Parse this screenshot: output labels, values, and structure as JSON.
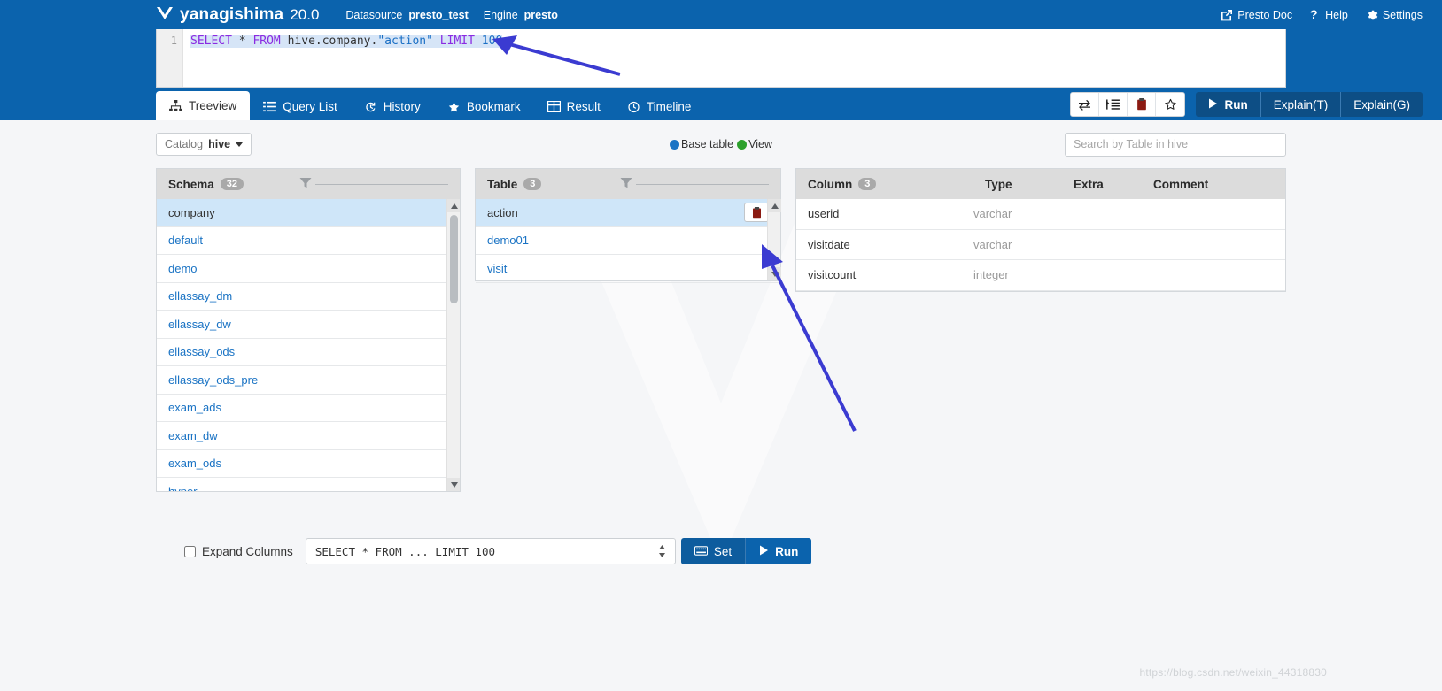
{
  "header": {
    "brand_name": "yanagishima",
    "version": "20.0",
    "datasource_label": "Datasource",
    "datasource_value": "presto_test",
    "engine_label": "Engine",
    "engine_value": "presto",
    "links": [
      {
        "label": "Presto Doc",
        "icon": "external-link-icon"
      },
      {
        "label": "Help",
        "icon": "question-mark-icon"
      },
      {
        "label": "Settings",
        "icon": "gear-icon"
      }
    ],
    "brand_color": "#0b63ad"
  },
  "editor": {
    "line_number": "1",
    "sql_tokens": [
      {
        "t": "SELECT",
        "c": "k"
      },
      {
        "t": " ",
        "c": "p"
      },
      {
        "t": "*",
        "c": "p"
      },
      {
        "t": " ",
        "c": "p"
      },
      {
        "t": "FROM",
        "c": "k"
      },
      {
        "t": " hive.company.",
        "c": "p"
      },
      {
        "t": "\"action\"",
        "c": "s"
      },
      {
        "t": " ",
        "c": "p"
      },
      {
        "t": "LIMIT",
        "c": "k"
      },
      {
        "t": " ",
        "c": "p"
      },
      {
        "t": "100",
        "c": "n"
      }
    ],
    "sql_plain": "SELECT * FROM hive.company.\"action\" LIMIT 100"
  },
  "tabs": [
    {
      "label": "Treeview",
      "icon": "sitemap-icon",
      "active": true
    },
    {
      "label": "Query List",
      "icon": "list-icon",
      "active": false
    },
    {
      "label": "History",
      "icon": "history-icon",
      "active": false
    },
    {
      "label": "Bookmark",
      "icon": "star-icon",
      "active": false
    },
    {
      "label": "Result",
      "icon": "table-icon",
      "active": false
    },
    {
      "label": "Timeline",
      "icon": "clock-icon",
      "active": false
    }
  ],
  "toolbar": {
    "icon_buttons": [
      {
        "name": "swap-icon",
        "title": "swap"
      },
      {
        "name": "format-indent-icon",
        "title": "format"
      },
      {
        "name": "clipboard-icon",
        "title": "copy"
      },
      {
        "name": "star-outline-icon",
        "title": "bookmark"
      }
    ],
    "run_label": "Run",
    "explain_t_label": "Explain(T)",
    "explain_g_label": "Explain(G)"
  },
  "treeview": {
    "catalog_label": "Catalog",
    "catalog_value": "hive",
    "legend": [
      {
        "label": "Base table",
        "color": "#1a73c4"
      },
      {
        "label": "View",
        "color": "#2ca02c"
      }
    ],
    "search_placeholder": "Search by Table in hive",
    "search_value": "",
    "schema": {
      "title": "Schema",
      "count": "32",
      "items": [
        {
          "label": "company",
          "selected": true
        },
        {
          "label": "default",
          "selected": false
        },
        {
          "label": "demo",
          "selected": false
        },
        {
          "label": "ellassay_dm",
          "selected": false
        },
        {
          "label": "ellassay_dw",
          "selected": false
        },
        {
          "label": "ellassay_ods",
          "selected": false
        },
        {
          "label": "ellassay_ods_pre",
          "selected": false
        },
        {
          "label": "exam_ads",
          "selected": false
        },
        {
          "label": "exam_dw",
          "selected": false
        },
        {
          "label": "exam_ods",
          "selected": false
        },
        {
          "label": "hyper",
          "selected": false
        }
      ]
    },
    "table": {
      "title": "Table",
      "count": "3",
      "items": [
        {
          "label": "action",
          "selected": true
        },
        {
          "label": "demo01",
          "selected": false
        },
        {
          "label": "visit",
          "selected": false
        }
      ]
    },
    "column": {
      "title": "Column",
      "count": "3",
      "headers": {
        "name": "Column",
        "type": "Type",
        "extra": "Extra",
        "comment": "Comment"
      },
      "rows": [
        {
          "name": "userid",
          "type": "varchar",
          "extra": "",
          "comment": ""
        },
        {
          "name": "visitdate",
          "type": "varchar",
          "extra": "",
          "comment": ""
        },
        {
          "name": "visitcount",
          "type": "integer",
          "extra": "",
          "comment": ""
        }
      ]
    }
  },
  "bottom": {
    "expand_columns_label": "Expand Columns",
    "expand_columns_checked": false,
    "query_template": "SELECT * FROM ... LIMIT 100",
    "set_label": "Set",
    "run_label": "Run"
  },
  "watermark": {
    "url_text": "https://blog.csdn.net/weixin_44318830"
  }
}
